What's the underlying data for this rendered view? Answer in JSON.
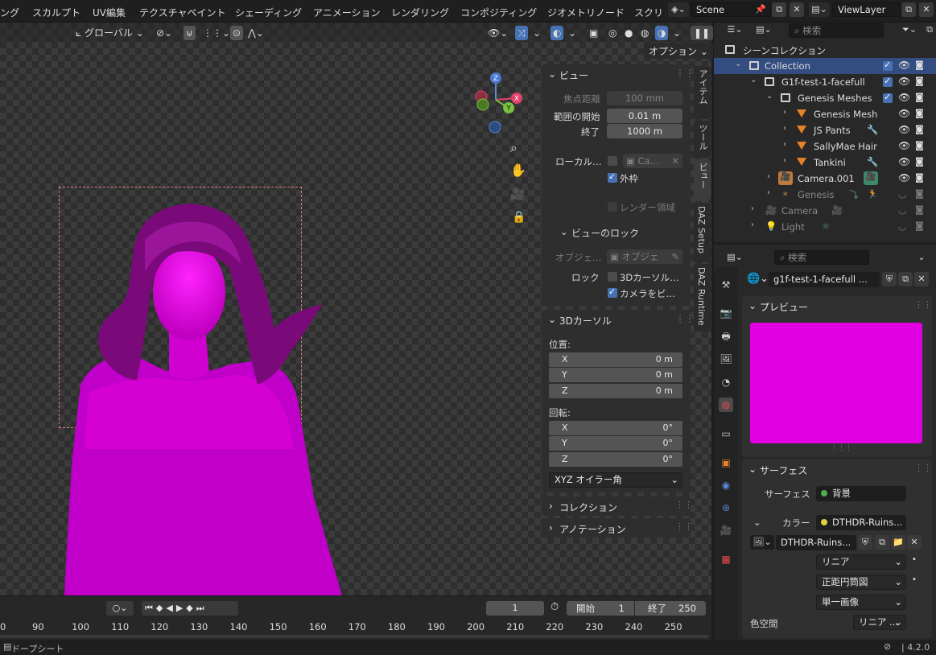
{
  "menubar": {
    "tabs": [
      "ング",
      "スカルプト",
      "UV編集",
      "テクスチャペイント",
      "シェーディング",
      "アニメーション",
      "レンダリング",
      "コンポジティング",
      "ジオメトリノード",
      "スクリ"
    ],
    "scene_label": "Scene",
    "viewlayer_label": "ViewLayer"
  },
  "viewport": {
    "transform_orientation": "グローバル",
    "options_label": "オプション"
  },
  "npanel": {
    "tabs": [
      "アイテム",
      "ツール",
      "ビュー",
      "DAZ Setup",
      "DAZ Runtime"
    ],
    "view": {
      "title": "ビュー",
      "focal_label": "焦点距離",
      "focal_value": "100 mm",
      "clip_start_label": "範囲の開始",
      "clip_start_value": "0.01 m",
      "clip_end_label": "終了",
      "clip_end_value": "1000 m",
      "local_camera_label": "ローカル…",
      "local_camera_value": "Ca…",
      "frame_label": "外枠",
      "render_region_label": "レンダー領域"
    },
    "view_lock": {
      "title": "ビューのロック",
      "object_label": "オブジェ…",
      "object_placeholder": "オブジェ",
      "lock_label": "ロック",
      "cursor_label": "3Dカーソル…",
      "camera_label": "カメラをビ…"
    },
    "cursor": {
      "title": "3Dカーソル",
      "position_label": "位置:",
      "rotation_label": "回転:",
      "position": [
        {
          "axis": "X",
          "value": "0 m"
        },
        {
          "axis": "Y",
          "value": "0 m"
        },
        {
          "axis": "Z",
          "value": "0 m"
        }
      ],
      "rotation": [
        {
          "axis": "X",
          "value": "0°"
        },
        {
          "axis": "Y",
          "value": "0°"
        },
        {
          "axis": "Z",
          "value": "0°"
        }
      ],
      "rotation_mode": "XYZ オイラー角"
    },
    "collections_title": "コレクション",
    "annotations_title": "アノテーション"
  },
  "timeline": {
    "current_frame": "1",
    "start_label": "開始",
    "start_value": "1",
    "end_label": "終了",
    "end_value": "250",
    "ticks": [
      "0",
      "90",
      "100",
      "110",
      "120",
      "130",
      "140",
      "150",
      "160",
      "170",
      "180",
      "190",
      "200",
      "210",
      "220",
      "230",
      "240",
      "250"
    ]
  },
  "statusbar": {
    "editor_label": "ドープシート",
    "version": "4.2.0"
  },
  "outliner": {
    "search_placeholder": "検索",
    "root_label": "シーンコレクション",
    "rows": [
      {
        "label": "Collection"
      },
      {
        "label": "G1f-test-1-facefull"
      },
      {
        "label": "Genesis Meshes"
      },
      {
        "label": "Genesis Mesh"
      },
      {
        "label": "JS Pants"
      },
      {
        "label": "SallyMae Hair"
      },
      {
        "label": "Tankini"
      },
      {
        "label": "Camera.001"
      },
      {
        "label": "Genesis"
      },
      {
        "label": "Camera"
      },
      {
        "label": "Light"
      }
    ]
  },
  "properties": {
    "search_placeholder": "検索",
    "world_name": "g1f-test-1-facefull ...",
    "preview_title": "プレビュー",
    "preview_color": "#e100e1",
    "surface_title": "サーフェス",
    "surface_label": "サーフェス",
    "surface_value": "背景",
    "color_label": "カラー",
    "color_value": "DTHDR-Ruins...",
    "image_name": "DTHDR-Ruins...",
    "interpolation": "リニア",
    "projection": "正距円筒図",
    "source": "単一画像",
    "colorspace_label": "色空間",
    "colorspace_value": "リニア ..."
  },
  "colors": {
    "accent": "#4772b3",
    "selection": "#334d80",
    "magenta": "#e100e1",
    "orange": "#e5822a"
  }
}
